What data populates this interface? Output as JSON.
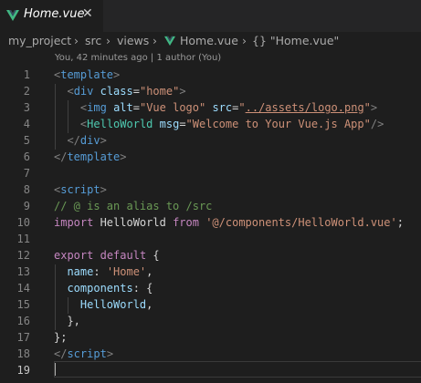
{
  "tab": {
    "icon": "vue-logo-icon",
    "label": "Home.vue",
    "close": "✕"
  },
  "breadcrumb": {
    "items": [
      "my_project",
      "src",
      "views",
      "Home.vue",
      "{} \"Home.vue\""
    ],
    "separator": "›"
  },
  "blame": "You, 42 minutes ago | 1 author (You)",
  "colors": {
    "tag": "#569cd6",
    "component_tag": "#4ec9b0",
    "attr": "#9cdcfe",
    "string": "#ce9178",
    "keyword": "#c586c0",
    "comment": "#6a9955",
    "punct": "#808080",
    "text": "#d4d4d4",
    "accent_vue": "#41b883"
  },
  "lines": [
    {
      "n": "1",
      "tokens": [
        [
          "<",
          "p"
        ],
        [
          "template",
          "t"
        ],
        [
          ">",
          "p"
        ]
      ]
    },
    {
      "n": "2",
      "tokens": [
        [
          "  ",
          "x"
        ],
        [
          "<",
          "p"
        ],
        [
          "div",
          "t"
        ],
        [
          " ",
          "x"
        ],
        [
          "class",
          "a"
        ],
        [
          "=",
          "x"
        ],
        [
          "\"home\"",
          "s"
        ],
        [
          ">",
          "p"
        ]
      ]
    },
    {
      "n": "3",
      "tokens": [
        [
          "    ",
          "x"
        ],
        [
          "<",
          "p"
        ],
        [
          "img",
          "t"
        ],
        [
          " ",
          "x"
        ],
        [
          "alt",
          "a"
        ],
        [
          "=",
          "x"
        ],
        [
          "\"Vue logo\"",
          "s"
        ],
        [
          " ",
          "x"
        ],
        [
          "src",
          "a"
        ],
        [
          "=",
          "x"
        ],
        [
          "\"",
          "s"
        ],
        [
          "../assets/logo.png",
          "su"
        ],
        [
          "\"",
          "s"
        ],
        [
          ">",
          "p"
        ]
      ]
    },
    {
      "n": "4",
      "tokens": [
        [
          "    ",
          "x"
        ],
        [
          "<",
          "p"
        ],
        [
          "HelloWorld",
          "c"
        ],
        [
          " ",
          "x"
        ],
        [
          "msg",
          "a"
        ],
        [
          "=",
          "x"
        ],
        [
          "\"Welcome to Your Vue.js App\"",
          "s"
        ],
        [
          "/>",
          "p"
        ]
      ]
    },
    {
      "n": "5",
      "tokens": [
        [
          "  ",
          "x"
        ],
        [
          "</",
          "p"
        ],
        [
          "div",
          "t"
        ],
        [
          ">",
          "p"
        ]
      ]
    },
    {
      "n": "6",
      "tokens": [
        [
          "</",
          "p"
        ],
        [
          "template",
          "t"
        ],
        [
          ">",
          "p"
        ]
      ]
    },
    {
      "n": "7",
      "tokens": []
    },
    {
      "n": "8",
      "tokens": [
        [
          "<",
          "p"
        ],
        [
          "script",
          "t"
        ],
        [
          ">",
          "p"
        ]
      ]
    },
    {
      "n": "9",
      "tokens": [
        [
          "// @ is an alias to /src",
          "m"
        ]
      ]
    },
    {
      "n": "10",
      "tokens": [
        [
          "import",
          "k"
        ],
        [
          " HelloWorld ",
          "x"
        ],
        [
          "from",
          "k"
        ],
        [
          " ",
          "x"
        ],
        [
          "'@/components/HelloWorld.vue'",
          "s"
        ],
        [
          ";",
          "x"
        ]
      ]
    },
    {
      "n": "11",
      "tokens": []
    },
    {
      "n": "12",
      "tokens": [
        [
          "export",
          "k"
        ],
        [
          " ",
          "x"
        ],
        [
          "default",
          "k"
        ],
        [
          " {",
          "x"
        ]
      ]
    },
    {
      "n": "13",
      "tokens": [
        [
          "  ",
          "x"
        ],
        [
          "name",
          "a"
        ],
        [
          ": ",
          "x"
        ],
        [
          "'Home'",
          "s"
        ],
        [
          ",",
          "x"
        ]
      ]
    },
    {
      "n": "14",
      "tokens": [
        [
          "  ",
          "x"
        ],
        [
          "components",
          "a"
        ],
        [
          ": {",
          "x"
        ]
      ]
    },
    {
      "n": "15",
      "tokens": [
        [
          "    ",
          "x"
        ],
        [
          "HelloWorld",
          "a"
        ],
        [
          ",",
          "x"
        ]
      ]
    },
    {
      "n": "16",
      "tokens": [
        [
          "  },",
          "x"
        ]
      ]
    },
    {
      "n": "17",
      "tokens": [
        [
          "};",
          "x"
        ]
      ]
    },
    {
      "n": "18",
      "tokens": [
        [
          "</",
          "p"
        ],
        [
          "script",
          "t"
        ],
        [
          ">",
          "p"
        ]
      ]
    },
    {
      "n": "19",
      "tokens": []
    }
  ]
}
